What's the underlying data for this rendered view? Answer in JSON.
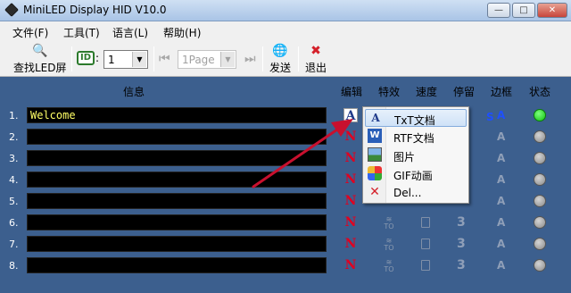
{
  "window": {
    "title": "MiniLED Display HID V10.0"
  },
  "menu": [
    "文件(F)",
    "工具(T)",
    "语言(L)",
    "帮助(H)"
  ],
  "toolbar": {
    "find_led": "查找LED屏",
    "id_label": "ID",
    "id_value": "1",
    "page_value": "1Page",
    "send": "发送",
    "exit": "退出"
  },
  "columns": {
    "info": "信息",
    "edit": "编辑",
    "effect": "特效",
    "speed": "速度",
    "stay": "停留",
    "border": "边框",
    "status": "状态"
  },
  "rows": [
    {
      "num": "1.",
      "text": "Welcome",
      "edit_icon": "A",
      "status": "on"
    },
    {
      "num": "2.",
      "text": "",
      "edit_icon": "N",
      "status": "off"
    },
    {
      "num": "3.",
      "text": "",
      "edit_icon": "N",
      "status": "off"
    },
    {
      "num": "4.",
      "text": "",
      "edit_icon": "N",
      "status": "off"
    },
    {
      "num": "5.",
      "text": "",
      "edit_icon": "N",
      "status": "off"
    },
    {
      "num": "6.",
      "text": "",
      "edit_icon": "N",
      "status": "off"
    },
    {
      "num": "7.",
      "text": "",
      "edit_icon": "N",
      "status": "off"
    },
    {
      "num": "8.",
      "text": "",
      "edit_icon": "N",
      "status": "off"
    }
  ],
  "effect_glyph": "TO",
  "stay_glyph": "3",
  "border_glyph": "A",
  "context_menu": {
    "items": [
      {
        "label": "TxT文档",
        "icon": "text-icon"
      },
      {
        "label": "RTF文档",
        "icon": "word-icon"
      },
      {
        "label": "图片",
        "icon": "image-icon"
      },
      {
        "label": "GIF动画",
        "icon": "gif-icon"
      },
      {
        "label": "Del...",
        "icon": "delete-icon"
      }
    ]
  },
  "colors": {
    "background": "#3c5f8e",
    "led_text": "#ffff66",
    "status_on": "#10c010",
    "arrow": "#c8102e"
  }
}
